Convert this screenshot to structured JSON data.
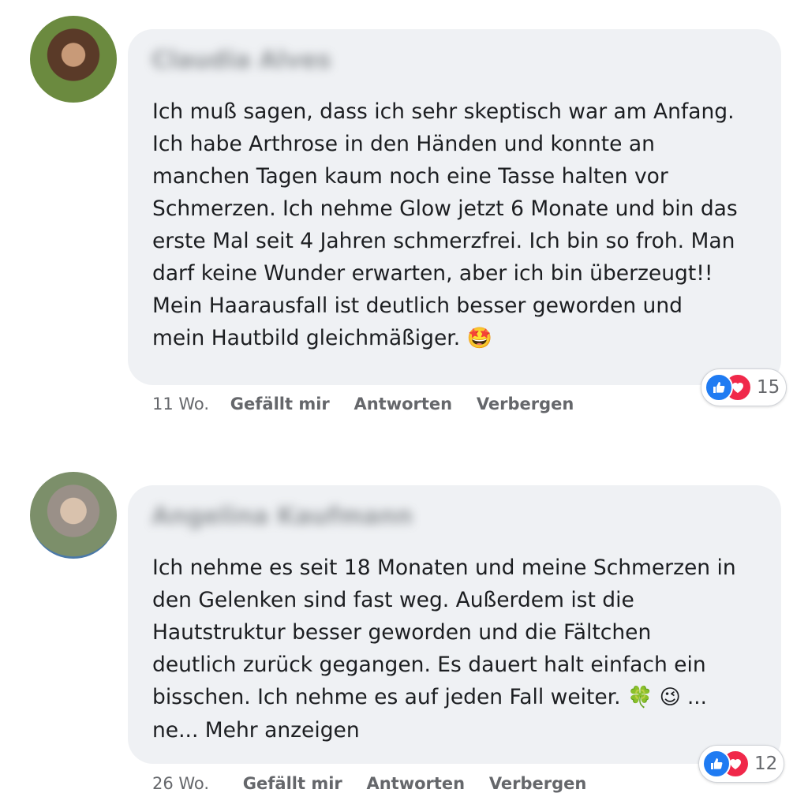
{
  "comments": [
    {
      "author": "Claudia Alves",
      "text": "Ich muß sagen, dass ich sehr skeptisch war am Anfang.\nIch habe Arthrose in den Händen und konnte an\nmanchen Tagen kaum noch eine Tasse halten vor\nSchmerzen. Ich nehme Glow jetzt 6 Monate und bin das\nerste Mal seit 4 Jahren schmerzfrei. Ich bin so froh. Man\ndarf keine Wunder erwarten, aber ich bin überzeugt!!\nMein Haarausfall ist deutlich besser geworden und\nmein Hautbild gleichmäßiger. ",
      "emoji": "🤩",
      "reaction_count": "15",
      "time": "11 Wo.",
      "like_label": "Gefällt mir",
      "reply_label": "Antworten",
      "hide_label": "Verbergen"
    },
    {
      "author": "Angelina Kaufmann",
      "text": "Ich nehme es seit 18 Monaten und meine Schmerzen in\nden Gelenken sind fast weg. Außerdem ist die\nHautstruktur besser geworden und die Fältchen\ndeutlich zurück gegangen. Es dauert halt einfach ein\nbisschen. Ich nehme es auf jeden Fall weiter. ",
      "emoji": "🍀 😉 ...",
      "more_prefix": "ne... ",
      "more_label": "Mehr anzeigen",
      "reaction_count": "12",
      "time": "26 Wo.",
      "like_label": "Gefällt mir",
      "reply_label": "Antworten",
      "hide_label": "Verbergen"
    }
  ],
  "reaction_icons": [
    "thumbs-up-icon",
    "heart-icon"
  ],
  "colors": {
    "like": "#1f7bf2",
    "love": "#f0284a",
    "bubble": "#eff1f4",
    "meta": "#65676b"
  }
}
